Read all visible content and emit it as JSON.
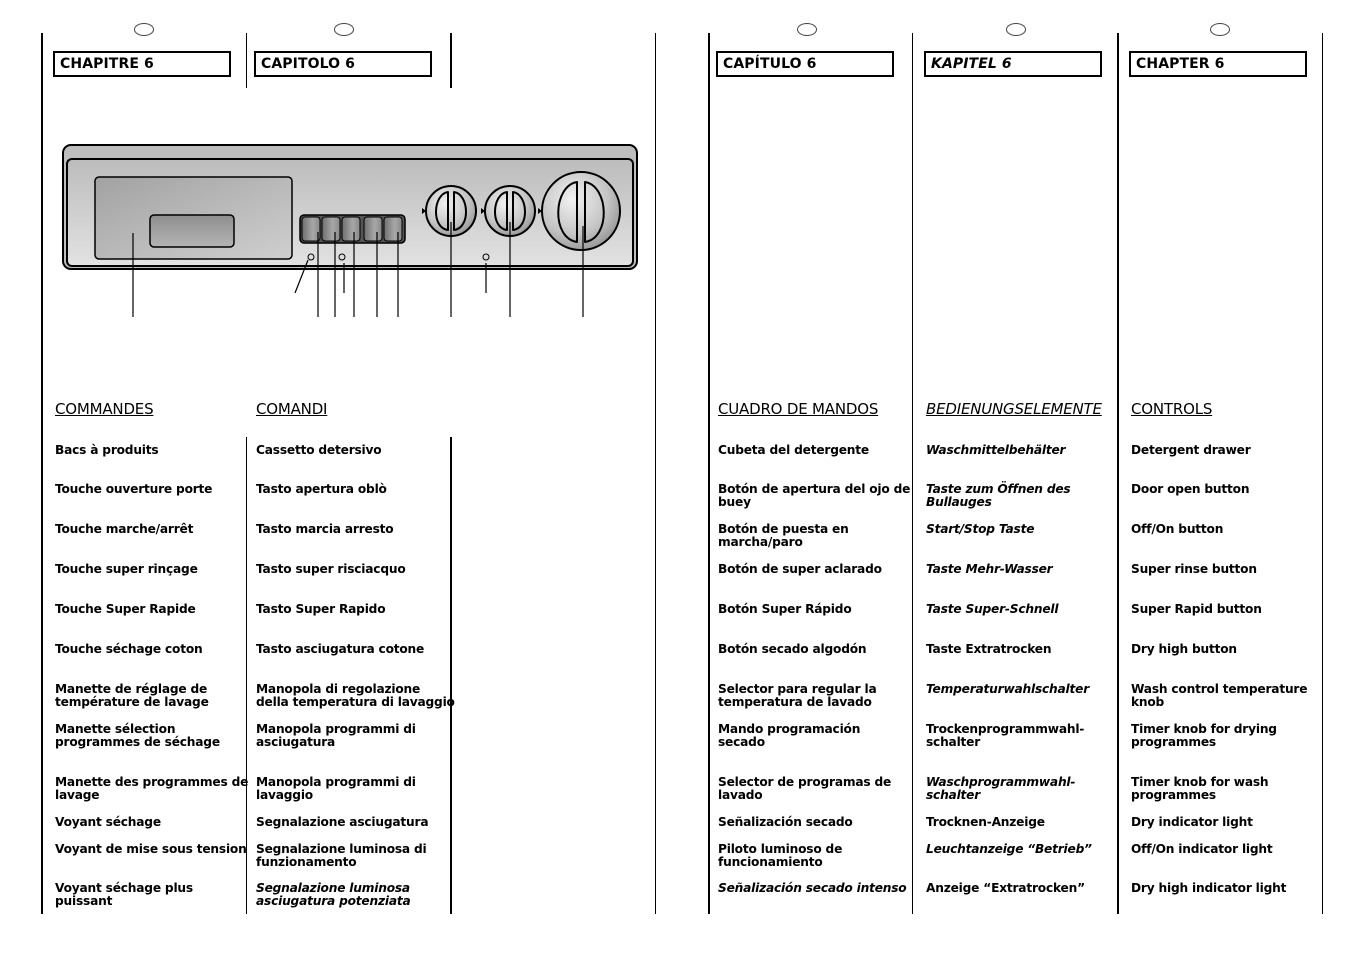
{
  "columns": [
    {
      "lang": "fr",
      "chapter": "CHAPITRE 6",
      "chapter_italic": false,
      "section_title": "COMMANDES",
      "section_italic": false,
      "items": [
        {
          "text": "Bacs à produits",
          "italic": false
        },
        {
          "text": "Touche ouverture porte",
          "italic": false
        },
        {
          "text": "Touche marche/arrêt",
          "italic": false
        },
        {
          "text": "Touche super rinçage",
          "italic": false
        },
        {
          "text": "Touche Super Rapide",
          "italic": false
        },
        {
          "text": "Touche séchage coton",
          "italic": false
        },
        {
          "text": "Manette de réglage de\ntempérature de lavage",
          "italic": false
        },
        {
          "text": "Manette sélection\nprogrammes de séchage",
          "italic": false
        },
        {
          "text": "Manette des programmes de\nlavage",
          "italic": false
        },
        {
          "text": "Voyant séchage",
          "italic": false
        },
        {
          "text": "Voyant de mise sous tension",
          "italic": false
        },
        {
          "text": "Voyant séchage plus\npuissant",
          "italic": false
        }
      ]
    },
    {
      "lang": "it",
      "chapter": "CAPITOLO 6",
      "chapter_italic": false,
      "section_title": "COMANDI",
      "section_italic": false,
      "items": [
        {
          "text": "Cassetto detersivo",
          "italic": false
        },
        {
          "text": "Tasto apertura oblò",
          "italic": false
        },
        {
          "text": "Tasto marcia arresto",
          "italic": false
        },
        {
          "text": "Tasto super risciacquo",
          "italic": false
        },
        {
          "text": "Tasto Super Rapido",
          "italic": false
        },
        {
          "text": "Tasto asciugatura cotone",
          "italic": false
        },
        {
          "text": "Manopola di regolazione\ndella temperatura di lavaggio",
          "italic": false
        },
        {
          "text": "Manopola programmi di\nasciugatura",
          "italic": false
        },
        {
          "text": "Manopola programmi di\nlavaggio",
          "italic": false
        },
        {
          "text": "Segnalazione asciugatura",
          "italic": false
        },
        {
          "text": "Segnalazione luminosa di\nfunzionamento",
          "italic": false
        },
        {
          "text": "Segnalazione luminosa\nasciugatura potenziata",
          "italic": true
        }
      ]
    },
    {
      "lang": "es",
      "chapter": "CAPÍTULO 6",
      "chapter_italic": false,
      "section_title": "CUADRO DE MANDOS",
      "section_italic": false,
      "items": [
        {
          "text": "Cubeta del detergente",
          "italic": false
        },
        {
          "text": "Botón de apertura del ojo de\nbuey",
          "italic": false
        },
        {
          "text": "Botón de puesta en\nmarcha/paro",
          "italic": false
        },
        {
          "text": "Botón de super aclarado",
          "italic": false
        },
        {
          "text": "Botón Super Rápido",
          "italic": false
        },
        {
          "text": "Botón secado algodón",
          "italic": false
        },
        {
          "text": "Selector para regular la\ntemperatura de lavado",
          "italic": false
        },
        {
          "text": "Mando programación\nsecado",
          "italic": false
        },
        {
          "text": "Selector de programas de\nlavado",
          "italic": false
        },
        {
          "text": "Señalización secado",
          "italic": false
        },
        {
          "text": "Piloto luminoso de\nfuncionamiento",
          "italic": false
        },
        {
          "text": "Señalización secado intenso",
          "italic": true
        }
      ]
    },
    {
      "lang": "de",
      "chapter": "KAPITEL 6",
      "chapter_italic": true,
      "section_title": "BEDIENUNGSELEMENTE",
      "section_italic": true,
      "items": [
        {
          "text": "Waschmittelbehälter",
          "italic": true
        },
        {
          "text": "Taste zum Öffnen des\nBullauges",
          "italic": true
        },
        {
          "text": "Start/Stop Taste",
          "italic": true
        },
        {
          "text": "Taste Mehr-Wasser",
          "italic": true
        },
        {
          "text": "Taste Super-Schnell",
          "italic": true
        },
        {
          "text": "Taste Extratrocken",
          "italic": false
        },
        {
          "text": "Temperaturwahlschalter",
          "italic": true
        },
        {
          "text": "Trockenprogrammwahl-\nschalter",
          "italic": false
        },
        {
          "text": "Waschprogrammwahl-\nschalter",
          "italic": true
        },
        {
          "text": "Trocknen-Anzeige",
          "italic": false
        },
        {
          "text": "Leuchtanzeige “Betrieb”",
          "italic": true
        },
        {
          "text": "Anzeige “Extratrocken”",
          "italic": false
        }
      ]
    },
    {
      "lang": "en",
      "chapter": "CHAPTER 6",
      "chapter_italic": false,
      "section_title": "CONTROLS",
      "section_italic": false,
      "items": [
        {
          "text": "Detergent drawer",
          "italic": false
        },
        {
          "text": "Door open button",
          "italic": false
        },
        {
          "text": "Off/On button",
          "italic": false
        },
        {
          "text": "Super rinse button",
          "italic": false
        },
        {
          "text": "Super Rapid button",
          "italic": false
        },
        {
          "text": "Dry high button",
          "italic": false
        },
        {
          "text": "Wash control temperature\nknob",
          "italic": false
        },
        {
          "text": "Timer knob for drying\nprogrammes",
          "italic": false
        },
        {
          "text": "Timer knob for wash\nprogrammes",
          "italic": false
        },
        {
          "text": "Dry indicator light",
          "italic": false
        },
        {
          "text": "Off/On indicator light",
          "italic": false
        },
        {
          "text": "Dry high indicator light",
          "italic": false
        }
      ]
    }
  ],
  "diagram": {
    "name": "washer-dryer-control-panel",
    "push_buttons": 5,
    "knobs": 3,
    "indicator_lights": 3,
    "colors": {
      "panel": "#c8c8c8",
      "outline": "#000000",
      "button": "#8a8a8a"
    }
  }
}
